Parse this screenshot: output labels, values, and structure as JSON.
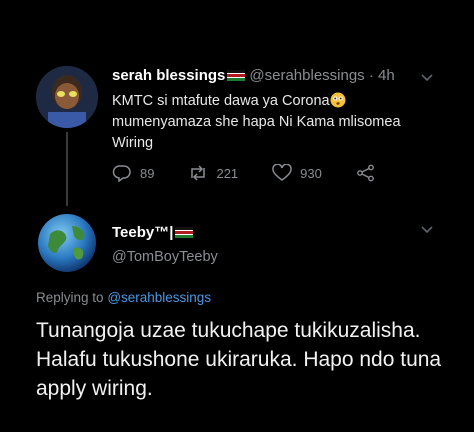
{
  "tweet": {
    "author_name": "serah blessings",
    "author_handle": "@serahblessings",
    "separator": "·",
    "time": "4h",
    "text": "KMTC si mtafute dawa ya Corona",
    "text_cont": "mumenyamaza she hapa Ni Kama mlisomea Wiring",
    "replies": "89",
    "retweets": "221",
    "likes": "930"
  },
  "reply": {
    "author_name": "Teeby™|",
    "author_handle": "@TomBoyTeeby",
    "replying_prefix": "Replying to",
    "replying_to": "@serahblessings",
    "text": "Tunangoja uzae tukuchape tukikuzalisha. Halafu tukushone ukiraruka. Hapo ndo tuna apply wiring."
  },
  "colors": {
    "background": "#000000",
    "secondary_text": "#8a8d91",
    "link": "#4a98e6"
  },
  "icons": [
    "reply-icon",
    "retweet-icon",
    "like-icon",
    "share-icon",
    "chevron-down-icon",
    "kenya-flag-icon",
    "flushed-face-emoji"
  ]
}
